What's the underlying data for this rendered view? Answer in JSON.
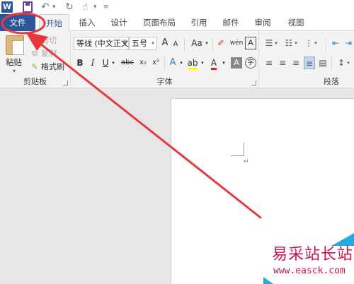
{
  "app": {
    "logo_letter": "W"
  },
  "quick_access": {
    "undo_icon": "undo-icon",
    "redo_icon": "redo-icon",
    "touch_icon": "touch-mode-icon",
    "customize_icon": "customize-icon"
  },
  "tabs": [
    {
      "label": "文件"
    },
    {
      "label": "开始"
    },
    {
      "label": "插入"
    },
    {
      "label": "设计"
    },
    {
      "label": "页面布局"
    },
    {
      "label": "引用"
    },
    {
      "label": "邮件"
    },
    {
      "label": "审阅"
    },
    {
      "label": "视图"
    }
  ],
  "clipboard": {
    "paste": "粘贴",
    "cut": "剪切",
    "copy": "复制",
    "format_painter": "格式刷",
    "group_label": "剪贴板"
  },
  "font": {
    "font_name": "等线 (中文正文",
    "font_size": "五号",
    "grow": "A",
    "shrink": "A",
    "change_case": "Aa",
    "phonetic": "wén",
    "bold": "B",
    "italic": "I",
    "underline": "U",
    "strike": "abc",
    "subscript": "x₂",
    "superscript": "x²",
    "text_effects": "A",
    "font_color": "A",
    "char_shading": "A",
    "enclose": "字",
    "group_label": "字体"
  },
  "paragraph": {
    "group_label": "段落"
  },
  "colors": {
    "accent": "#2b579a",
    "annotation": "#e8383d",
    "font_red": "#e02020",
    "highlight": "#ffff00"
  },
  "watermark": {
    "title": "易采站长站",
    "url": "www.easck.com"
  }
}
